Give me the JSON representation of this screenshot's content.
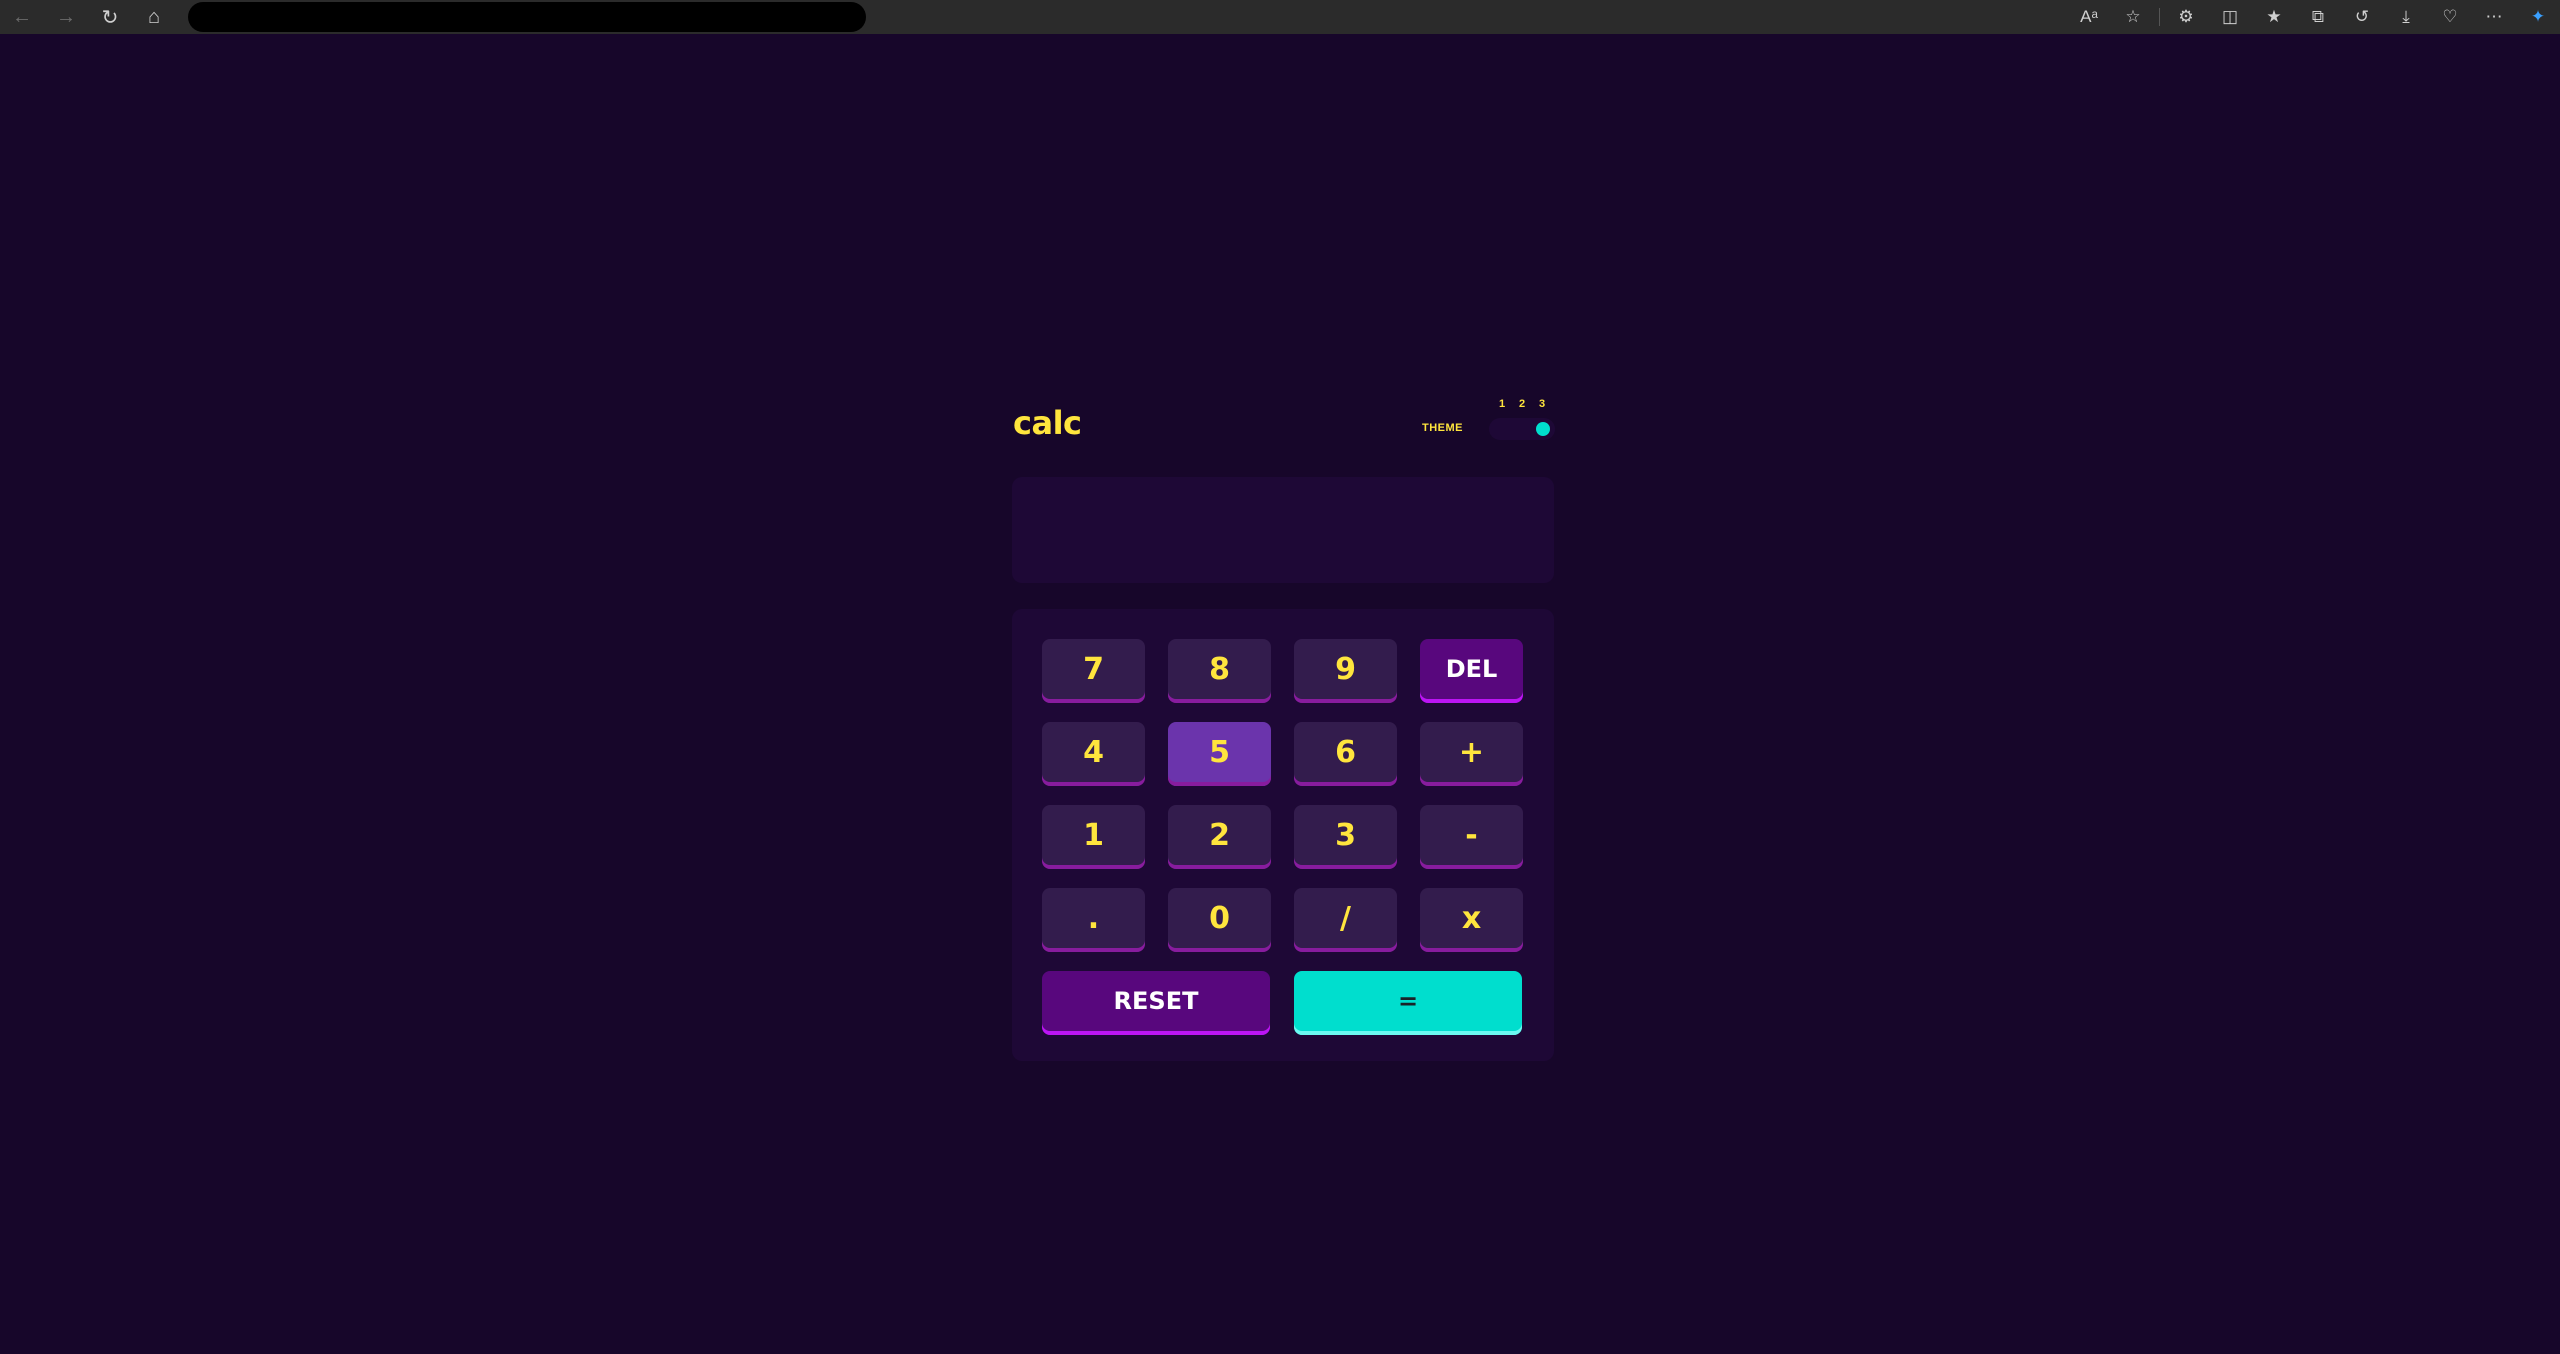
{
  "browser": {
    "nav_icons": [
      "back-arrow-icon",
      "forward-arrow-icon",
      "refresh-icon",
      "home-icon"
    ],
    "tool_icons": [
      "read-aloud-icon",
      "favorite-star-icon",
      "extensions-icon",
      "split-screen-icon",
      "favorites-icon",
      "collections-icon",
      "history-icon",
      "downloads-icon",
      "performance-icon",
      "more-icon",
      "copilot-icon"
    ]
  },
  "calculator": {
    "brand": "calc",
    "theme_label": "THEME",
    "theme_options": [
      "1",
      "2",
      "3"
    ],
    "selected_theme": "3",
    "display_value": "",
    "keys": {
      "k7": "7",
      "k8": "8",
      "k9": "9",
      "del": "DEL",
      "k4": "4",
      "k5": "5",
      "k6": "6",
      "plus": "+",
      "k1": "1",
      "k2": "2",
      "k3": "3",
      "minus": "-",
      "dot": ".",
      "k0": "0",
      "divide": "/",
      "times": "x",
      "reset": "RESET",
      "equals": "="
    },
    "hovered_key": "5"
  },
  "colors": {
    "background": "#17062a",
    "panel": "#1e0836",
    "key": "#331c4d",
    "key_shadow": "#881c9e",
    "key_text": "#ffe53d",
    "accent_purple": "#58077d",
    "accent_cyan": "#00dece"
  }
}
